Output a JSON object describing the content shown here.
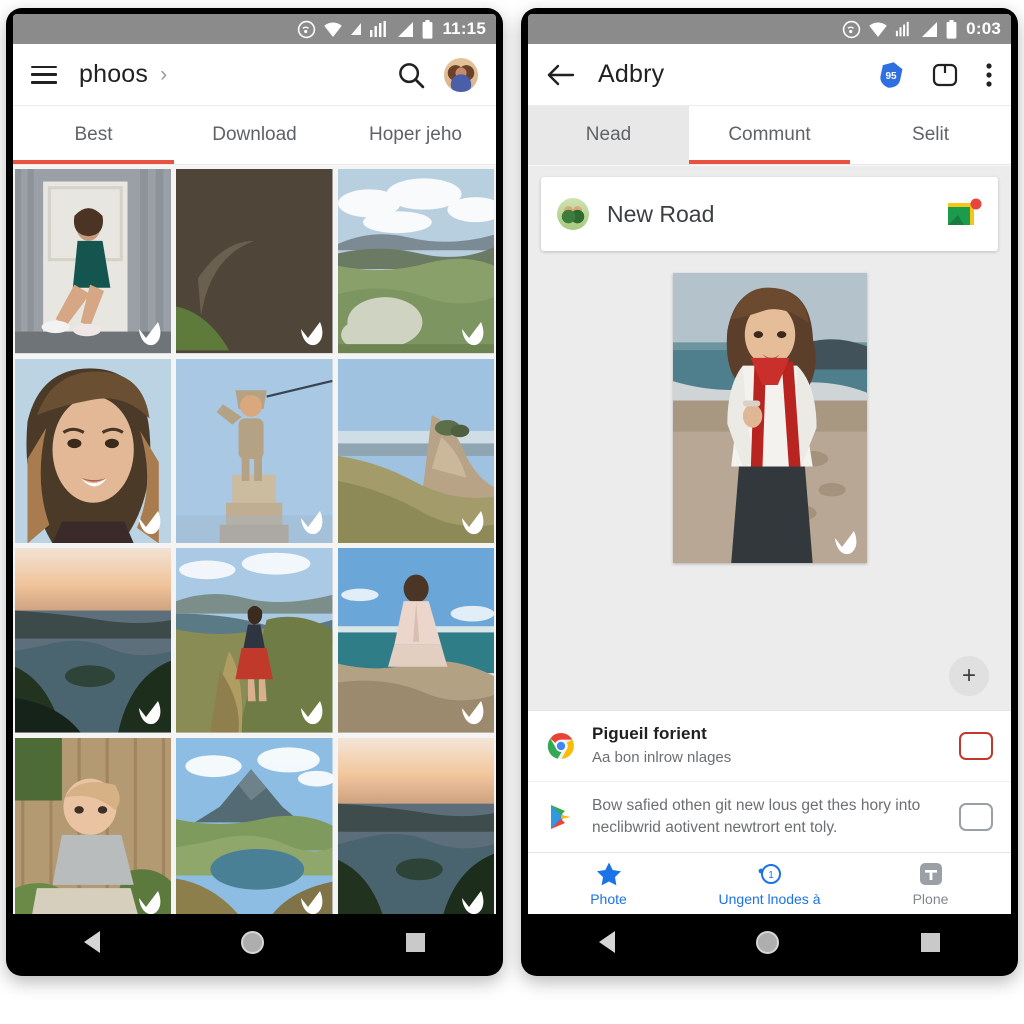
{
  "theme": {
    "accent": "#e8523f",
    "status_bar_bg": "#8b8b8b",
    "blue": "#1a73e8"
  },
  "left_phone": {
    "status_bar": {
      "time": "11:15",
      "icons": [
        "hotspot-icon",
        "wifi-icon",
        "signal-small-icon",
        "signal-bars-icon",
        "signal-triangle-icon",
        "battery-icon"
      ]
    },
    "app_bar": {
      "menu_icon": "hamburger-icon",
      "title": "phoos",
      "chevron": "›",
      "search_icon": "search-icon",
      "avatar": "avatar"
    },
    "tabs": [
      {
        "label": "Best",
        "active": true
      },
      {
        "label": "Download",
        "active": false
      },
      {
        "label": "Hoper jeho",
        "active": false
      }
    ],
    "grid": {
      "badge_icon": "check-badge-icon",
      "items": [
        {
          "name": "photo-woman-seated-door"
        },
        {
          "name": "photo-arch-church-view"
        },
        {
          "name": "photo-green-hills"
        },
        {
          "name": "photo-woman-portrait-smiling"
        },
        {
          "name": "photo-child-on-monument"
        },
        {
          "name": "photo-coastal-cliff"
        },
        {
          "name": "photo-sunset-bay"
        },
        {
          "name": "photo-woman-red-skirt-trail"
        },
        {
          "name": "photo-woman-rock-ocean"
        },
        {
          "name": "photo-baby-fence"
        },
        {
          "name": "photo-mountain-lake"
        },
        {
          "name": "photo-sunset-bay-2"
        }
      ]
    }
  },
  "right_phone": {
    "status_bar": {
      "time": "0:03",
      "icons": [
        "hotspot-icon",
        "wifi-icon",
        "signal-bars-icon",
        "signal-triangle-icon",
        "battery-icon"
      ]
    },
    "app_bar": {
      "back_icon": "back-arrow-icon",
      "title": "Adbry",
      "badge_icon": "blue-badge-icon",
      "badge_text": "95",
      "box_icon": "box-icon",
      "overflow_icon": "overflow-menu-icon"
    },
    "tabs": [
      {
        "label": "Nead",
        "active": false
      },
      {
        "label": "Communt",
        "active": true
      },
      {
        "label": "Selit",
        "active": false
      }
    ],
    "road_card": {
      "avatar": "group-avatar",
      "title": "New Road",
      "maps_icon": "google-maps-icon"
    },
    "hero": {
      "photo_name": "photo-woman-red-scarf-beach",
      "badge_icon": "check-badge-icon",
      "fab_label": "+",
      "fab_name": "add-button"
    },
    "list": [
      {
        "icon": "chrome-icon",
        "title": "Pigueil forient",
        "subtitle": "Aa bon inlrow nlages",
        "checkbox": "red"
      },
      {
        "icon": "play-store-icon",
        "body": "Bow safied othen git new lous get thes hory into neclibwrid aotivent newtrort ent toly.",
        "checkbox": "grey"
      }
    ],
    "bottom_nav": [
      {
        "icon": "star-icon",
        "label": "Phote",
        "active": true
      },
      {
        "icon": "clock-badge-icon",
        "label": "Ungent lnodes à",
        "active": true
      },
      {
        "icon": "t-box-icon",
        "label": "Plone",
        "active": false
      }
    ]
  },
  "android_nav": {
    "back": "back-triangle-icon",
    "home": "home-circle-icon",
    "recents": "recents-square-icon"
  }
}
